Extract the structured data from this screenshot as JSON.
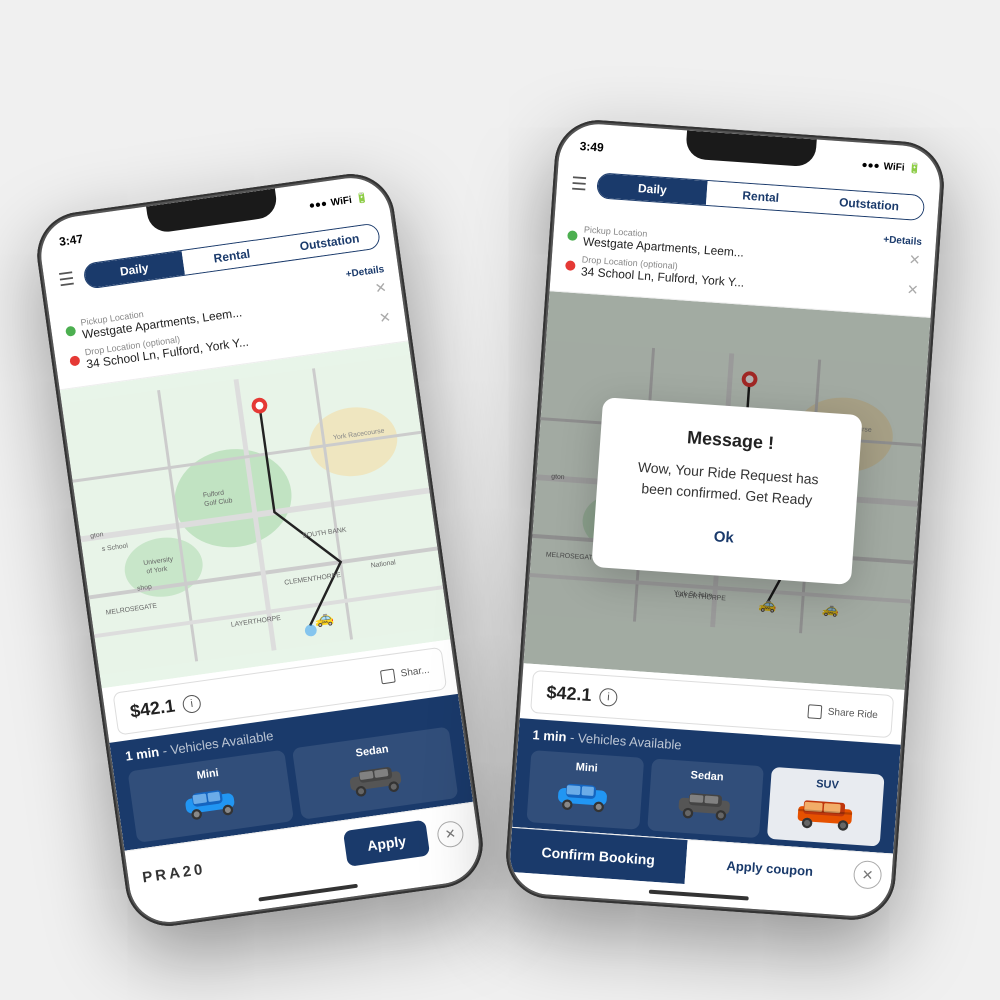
{
  "scene": {
    "background": "#e8e8e8"
  },
  "phone_left": {
    "time": "3:47",
    "tabs": [
      "Daily",
      "Rental",
      "Outstation"
    ],
    "active_tab": "Daily",
    "pickup_label": "Pickup Location",
    "pickup_value": "Westgate Apartments, Leem...",
    "drop_label": "Drop Location (optional)",
    "drop_value": "34 School Ln, Fulford, York Y...",
    "details_link": "+Details",
    "price": "$42.1",
    "share_ride_label": "Shar...",
    "vehicles_avail": "1 min",
    "vehicles_avail_label": "- Vehicles Available",
    "vehicles": [
      "Mini",
      "Sedan"
    ],
    "coupon_code": "PRA20",
    "apply_label": "Apply"
  },
  "phone_right": {
    "time": "3:49",
    "tabs": [
      "Daily",
      "Rental",
      "Outstation"
    ],
    "active_tab": "Daily",
    "pickup_label": "Pickup Location",
    "pickup_value": "Westgate Apartments, Leem...",
    "drop_label": "Drop Location (optional)",
    "drop_value": "34 School Ln, Fulford, York Y...",
    "details_link": "+Details",
    "price": "$42.1",
    "share_ride_label": "Share Ride",
    "vehicles_avail": "1 min",
    "vehicles_avail_label": "- Vehicles Available",
    "vehicles": [
      "Mini",
      "Sedan",
      "SUV"
    ],
    "active_vehicle": "SUV",
    "confirm_label": "Confirm Booking",
    "coupon_label": "Apply coupon",
    "modal": {
      "title": "Message !",
      "message": "Wow, Your Ride Request has been confirmed. Get Ready",
      "ok_label": "Ok"
    }
  }
}
